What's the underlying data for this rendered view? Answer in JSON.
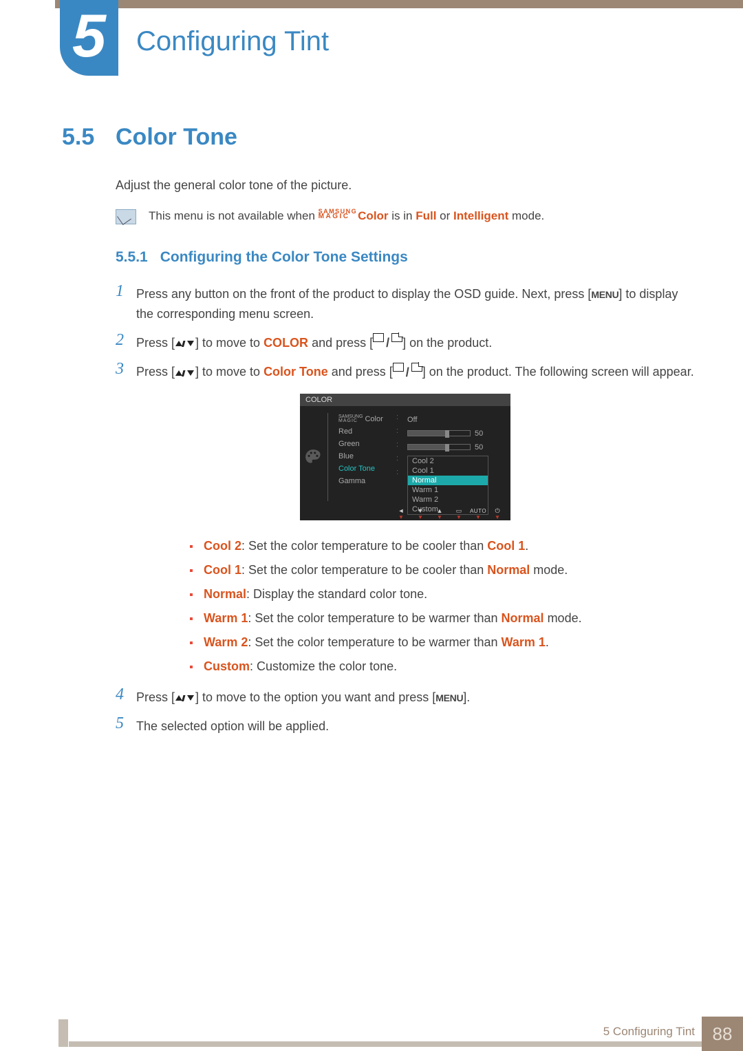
{
  "chapter": {
    "number": "5",
    "title": "Configuring Tint"
  },
  "section": {
    "number": "5.5",
    "title": "Color Tone"
  },
  "intro_text": "Adjust the general color tone of the picture.",
  "note": {
    "prefix": "This menu is not available when ",
    "magic_top": "SAMSUNG",
    "magic_bot": "MAGIC",
    "color_word": "Color",
    "mid": " is in ",
    "mode1": "Full",
    "mid2": " or ",
    "mode2": "Intelligent",
    "suffix": " mode."
  },
  "subsection": {
    "number": "5.5.1",
    "title": "Configuring the Color Tone Settings"
  },
  "steps": [
    {
      "n": "1",
      "plain_a": "Press any button on the front of the product to display the OSD guide. Next, press [",
      "btn": "MENU",
      "plain_b": "] to display the corresponding menu screen."
    },
    {
      "n": "2",
      "plain_a": "Press [",
      "arrows": true,
      "plain_b": "] to move to ",
      "kw": "COLOR",
      "plain_c": " and press [",
      "source": true,
      "plain_d": "] on the product."
    },
    {
      "n": "3",
      "plain_a": "Press [",
      "arrows": true,
      "plain_b": "] to move to ",
      "kw": "Color Tone",
      "plain_c": " and press [",
      "source": true,
      "plain_d": "] on the product. The following screen will appear."
    },
    {
      "n": "4",
      "plain_a": "Press [",
      "arrows": true,
      "plain_b": "] to move to the option you want and press [",
      "btn": "MENU",
      "plain_c": "]."
    },
    {
      "n": "5",
      "plain_a": "The selected option will be applied."
    }
  ],
  "osd": {
    "title": "COLOR",
    "rows": {
      "magic_top": "SAMSUNG",
      "magic_bot": "MAGIC",
      "magic_suffix": " Color",
      "magic_value": "Off",
      "red_label": "Red",
      "red_value": "50",
      "green_label": "Green",
      "green_value": "50",
      "blue_label": "Blue",
      "ct_label": "Color Tone",
      "gamma_label": "Gamma"
    },
    "dropdown": [
      "Cool 2",
      "Cool 1",
      "Normal",
      "Warm 1",
      "Warm 2",
      "Custom"
    ],
    "dropdown_selected_index": 2,
    "footer_icons": [
      "◄",
      "▼",
      "▲",
      "▶"
    ],
    "footer_auto": "AUTO"
  },
  "bullets": [
    {
      "kw": "Cool 2",
      "text_a": ": Set the color temperature to be cooler than ",
      "kw2": "Cool 1",
      "text_b": "."
    },
    {
      "kw": "Cool 1",
      "text_a": ": Set the color temperature to be cooler than ",
      "kw2": "Normal",
      "text_b": " mode."
    },
    {
      "kw": "Normal",
      "text_a": ": Display the standard color tone.",
      "kw2": "",
      "text_b": ""
    },
    {
      "kw": "Warm 1",
      "text_a": ": Set the color temperature to be warmer than ",
      "kw2": "Normal",
      "text_b": " mode."
    },
    {
      "kw": "Warm 2",
      "text_a": ": Set the color temperature to be warmer than ",
      "kw2": "Warm 1",
      "text_b": "."
    },
    {
      "kw": "Custom",
      "text_a": ": Customize the color tone.",
      "kw2": "",
      "text_b": ""
    }
  ],
  "footer": {
    "label": "5 Configuring Tint",
    "page": "88"
  }
}
